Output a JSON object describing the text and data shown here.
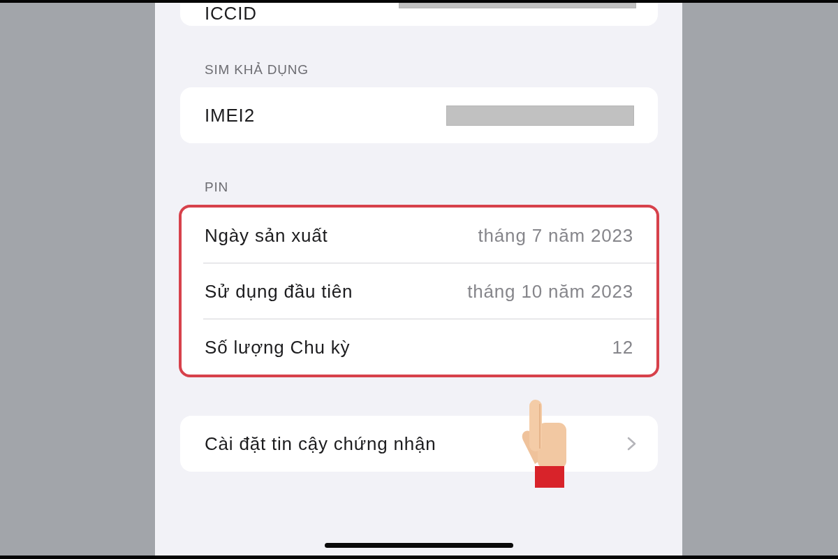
{
  "sections": [
    {
      "highlighted": false,
      "rows": [
        {
          "kind": "redacted",
          "label": "ICCID"
        }
      ]
    },
    {
      "header": "SIM KHẢ DỤNG",
      "highlighted": false,
      "rows": [
        {
          "kind": "redacted",
          "label": "IMEI2"
        }
      ]
    },
    {
      "header": "PIN",
      "highlighted": true,
      "rows": [
        {
          "kind": "value",
          "label": "Ngày sản xuất",
          "value": "tháng 7 năm 2023"
        },
        {
          "kind": "value",
          "label": "Sử dụng đầu tiên",
          "value": "tháng 10 năm 2023"
        },
        {
          "kind": "value",
          "label": "Số lượng Chu kỳ",
          "value": "12"
        }
      ]
    },
    {
      "highlighted": false,
      "rows": [
        {
          "kind": "link",
          "label": "Cài đặt tin cậy chứng nhận"
        }
      ]
    }
  ]
}
